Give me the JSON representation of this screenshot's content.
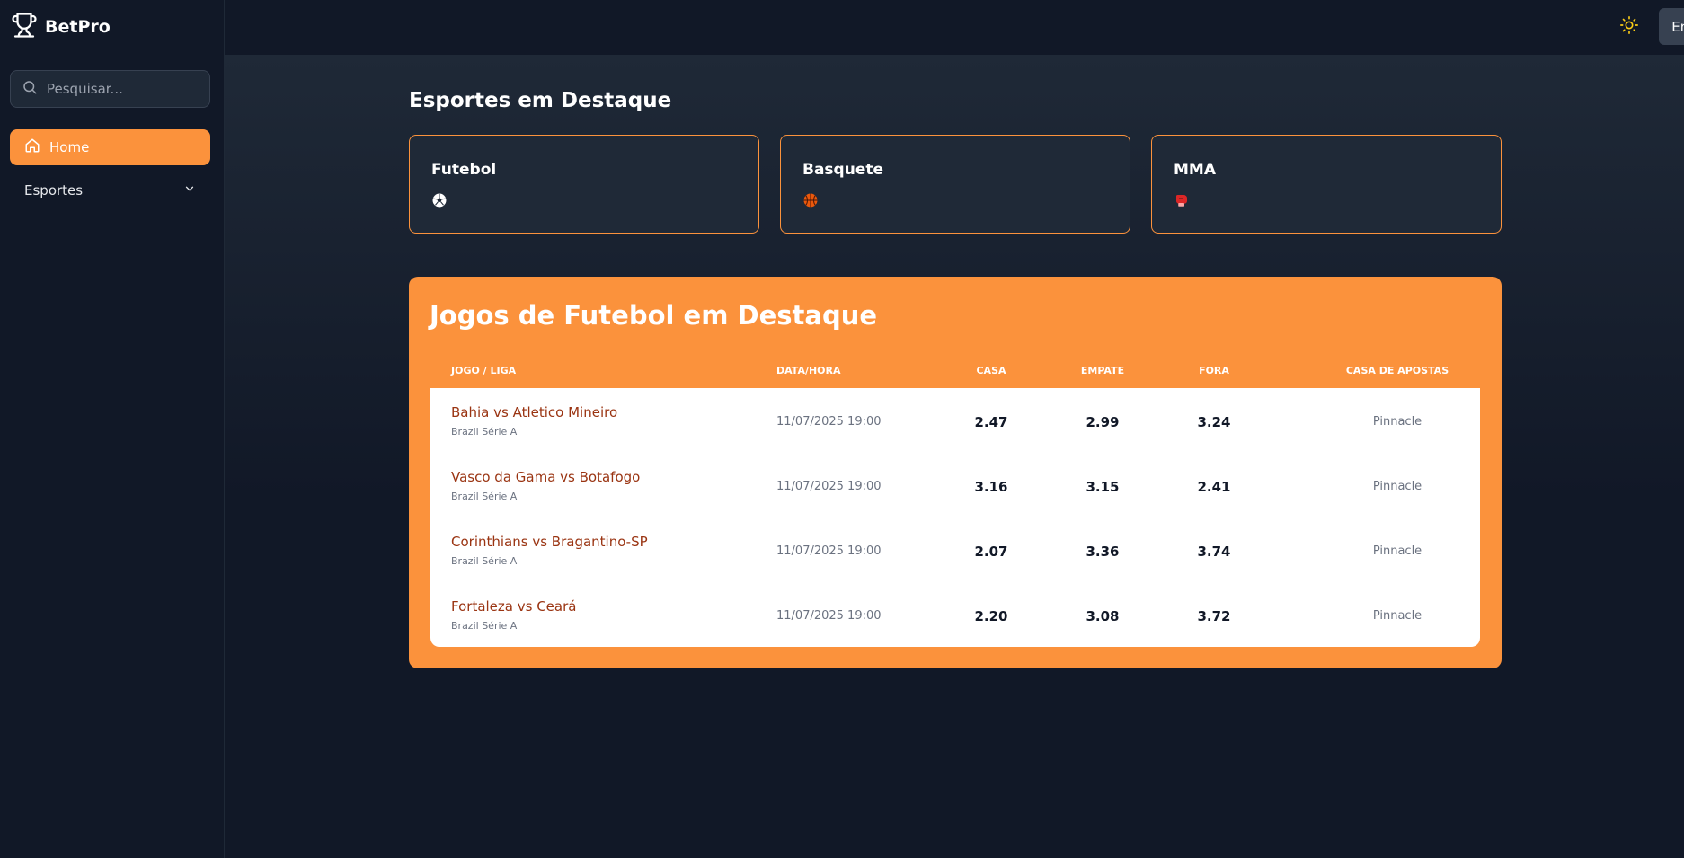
{
  "app": {
    "name": "BetPro"
  },
  "sidebar": {
    "search_placeholder": "Pesquisar...",
    "items": [
      {
        "label": "Home",
        "icon": "home-icon",
        "active": true
      },
      {
        "label": "Esportes",
        "icon": "chevron-down-icon",
        "active": false
      }
    ]
  },
  "header": {
    "theme_icon": "sun-icon",
    "login_label": "Entrar"
  },
  "colors": {
    "accent": "#fb923c",
    "background": "#111827",
    "panel": "#1f2937",
    "match_text": "#9a3412"
  },
  "sports_section": {
    "title": "Esportes em Destaque",
    "cards": [
      {
        "name": "Futebol",
        "icon": "soccer-ball-icon"
      },
      {
        "name": "Basquete",
        "icon": "basketball-icon"
      },
      {
        "name": "MMA",
        "icon": "boxing-glove-icon"
      }
    ]
  },
  "featured_games": {
    "title": "Jogos de Futebol em Destaque",
    "columns": [
      "Jogo / Liga",
      "Data/Hora",
      "Casa",
      "Empate",
      "Fora",
      "Casa de Apostas"
    ],
    "rows": [
      {
        "match": "Bahia vs Atletico Mineiro",
        "league": "Brazil Série A",
        "datetime": "11/07/2025 19:00",
        "home": "2.47",
        "draw": "2.99",
        "away": "3.24",
        "bookmaker": "Pinnacle"
      },
      {
        "match": "Vasco da Gama vs Botafogo",
        "league": "Brazil Série A",
        "datetime": "11/07/2025 19:00",
        "home": "3.16",
        "draw": "3.15",
        "away": "2.41",
        "bookmaker": "Pinnacle"
      },
      {
        "match": "Corinthians vs Bragantino-SP",
        "league": "Brazil Série A",
        "datetime": "11/07/2025 19:00",
        "home": "2.07",
        "draw": "3.36",
        "away": "3.74",
        "bookmaker": "Pinnacle"
      },
      {
        "match": "Fortaleza vs Ceará",
        "league": "Brazil Série A",
        "datetime": "11/07/2025 19:00",
        "home": "2.20",
        "draw": "3.08",
        "away": "3.72",
        "bookmaker": "Pinnacle"
      }
    ]
  }
}
